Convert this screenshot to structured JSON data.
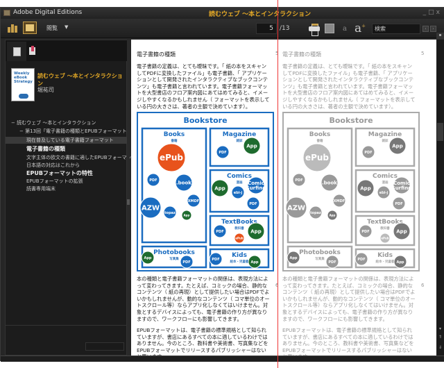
{
  "window": {
    "app_title": "Adobe Digital Editions",
    "doc_title": "読むウェブ 〜本とインタラクション",
    "controls": [
      "minimize",
      "maximize",
      "close"
    ]
  },
  "toolbar": {
    "library_icon": "library-icon",
    "reading_icon": "reading-view-icon",
    "view_label": "閲覧",
    "current_page": "5",
    "total_pages": "/13",
    "print_icon": "print-icon",
    "fit_icon": "book-fit-icon",
    "font_small": "a",
    "font_large": "a",
    "search_placeholder": "検索"
  },
  "sidebar": {
    "tabs": [
      "toc-tab",
      "bookmark-tab"
    ],
    "book": {
      "cover_text": "Weekly eBook Strategy",
      "title": "読むウェブ 〜本とインタラクション",
      "author": "堀祐司"
    },
    "toc": [
      {
        "label": "読むウェブ 〜本とインタラクション",
        "level": 0,
        "expanded": true
      },
      {
        "label": "第13回「電子書籍の種類とEPUBフォーマット」",
        "level": 1,
        "expanded": true
      },
      {
        "label": "現在普及している電子書籍フォーマット",
        "level": 2,
        "selected": true
      },
      {
        "label": "電子書籍の種類",
        "level": 2,
        "bold": true
      },
      {
        "label": "文字主体の欧文の書籍に適したEPUBフォーマット",
        "level": 2
      },
      {
        "label": "日本語の対応はこれから",
        "level": 2
      },
      {
        "label": "EPUBフォーマットの特性",
        "level": 2,
        "bold": true
      },
      {
        "label": "EPUBフォーマットの拡張",
        "level": 2
      },
      {
        "label": "読書専用端末",
        "level": 2
      }
    ]
  },
  "pages": {
    "section_heading": "電子書籍の種類",
    "page_num_top": "5",
    "page_num_bottom": "6",
    "para1": "電子書籍の定義は、とても曖昧です。「 紙の本をスキャンしてPDFに変換したファイル」も電子書籍、「 アプリケーションとして開発されたインタラクティブなブックコンテンツ」も電子書籍と言われています。電子書籍フォーマットを大型書店のフロア案内図にあてはめてみると、イメージしやすくなるかもしれません（ フォーマットを表示している円の大きさは、著者の主観で決めています）。",
    "para2": "本の種類と電子書籍フォーマットの関係は、表現方法によって変わってきます。たとえば、コミックの場合、静的なコンテンツ（ 紙の再現）として提供したい場合はPDFでよいかもしれませんが、動的なコンテンツ（ コマ単位のオートスクロール等）ならアプリ化しなくてはいけません。対象とするデバイスによっても、電子書籍の作り方が異なりますので、ワークフローにも影響してきます。",
    "para3": "EPUBフォーマットは、電子書籍の標準規格として知られていますが、書店にあるすべての本に適しているわけではありません。今のところ、教科書や美術書、写真集などをEPUBフォーマットでリリースするパブリッシャーはないと思います。"
  },
  "diagram": {
    "title": "Bookstore",
    "colors": {
      "blue": "#1a6cc0",
      "green": "#1e6b2e",
      "orange": "#e8531c",
      "border": "#1a6cc0"
    },
    "sections": [
      {
        "name": "Books",
        "sub": "書籍",
        "circles": [
          {
            "label": "ePub",
            "color": "orange",
            "size": "xl"
          },
          {
            "label": "PDF",
            "color": "blue",
            "size": "s"
          },
          {
            "label": ".book",
            "color": "blue",
            "size": "m"
          },
          {
            "label": "AZW",
            "color": "blue",
            "size": "l"
          },
          {
            "label": "XMDF",
            "color": "blue",
            "size": "s"
          },
          {
            "label": "topaz",
            "color": "blue",
            "size": "s"
          },
          {
            "label": "App",
            "color": "green",
            "size": "xs"
          }
        ]
      },
      {
        "name": "Magazine",
        "sub": "雑誌",
        "circles": [
          {
            "label": "PDF",
            "color": "blue",
            "size": "s"
          },
          {
            "label": "App",
            "color": "green",
            "size": "m"
          }
        ]
      },
      {
        "name": "Comics",
        "sub": "漫画",
        "circles": [
          {
            "label": "App",
            "color": "green",
            "size": "m"
          },
          {
            "label": "ebi-j",
            "color": "blue",
            "size": "s"
          },
          {
            "label": "Comic Surfing",
            "color": "blue",
            "size": "m"
          },
          {
            "label": "PDF",
            "color": "blue",
            "size": "s"
          }
        ]
      },
      {
        "name": "TextBooks",
        "sub": "教科書",
        "circles": [
          {
            "label": "PDF",
            "color": "blue",
            "size": "s"
          },
          {
            "label": "ePub",
            "color": "orange",
            "size": "xs"
          },
          {
            "label": "App",
            "color": "green",
            "size": "m"
          }
        ]
      },
      {
        "name": "Photobooks",
        "sub": "写真集",
        "circles": [
          {
            "label": "App",
            "color": "green",
            "size": "s"
          },
          {
            "label": "PDF",
            "color": "blue",
            "size": "s"
          }
        ]
      },
      {
        "name": "Kids",
        "sub": "絵本・児童書",
        "circles": [
          {
            "label": "PDF",
            "color": "blue",
            "size": "s"
          },
          {
            "label": "App",
            "color": "green",
            "size": "s"
          }
        ]
      }
    ]
  }
}
